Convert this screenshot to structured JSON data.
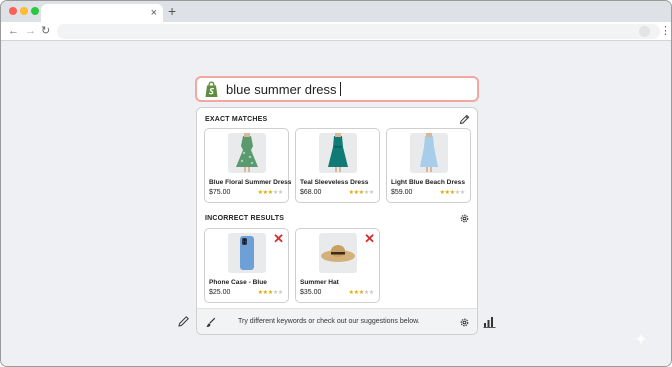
{
  "browser": {
    "tab_close": "×",
    "tab_new": "+",
    "nav": {
      "back": "←",
      "forward": "→",
      "reload": "↻",
      "menu": "⋮"
    },
    "colors": {
      "close": "#fe5f57",
      "minimize": "#febc2e",
      "zoom": "#28c840"
    }
  },
  "search": {
    "query": "blue summer dress",
    "logo_icon": "shopify-bag-icon"
  },
  "exact": {
    "title": "EXACT MATCHES",
    "action_icon": "pencil-icon",
    "items": [
      {
        "name": "Blue Floral Summer Dress",
        "price": "$75.00",
        "rating": 3
      },
      {
        "name": "Teal Sleeveless Dress",
        "price": "$68.00",
        "rating": 3
      },
      {
        "name": "Light Blue Beach Dress",
        "price": "$59.00",
        "rating": 3
      }
    ]
  },
  "incorrect": {
    "title": "INCORRECT RESULTS",
    "action_icon": "gear-icon",
    "items": [
      {
        "name": "Phone Case - Blue",
        "price": "$25.00",
        "rating": 3,
        "mark": "✕"
      },
      {
        "name": "Summer Hat",
        "price": "$35.00",
        "rating": 3,
        "mark": "✕"
      }
    ]
  },
  "footer": {
    "message": "Try different keywords or check out our suggestions below."
  },
  "colors": {
    "accent_border": "#f2a7a0",
    "reject": "#d62d2d",
    "star": "#e0a800",
    "shopify": "#5e8e3e"
  }
}
